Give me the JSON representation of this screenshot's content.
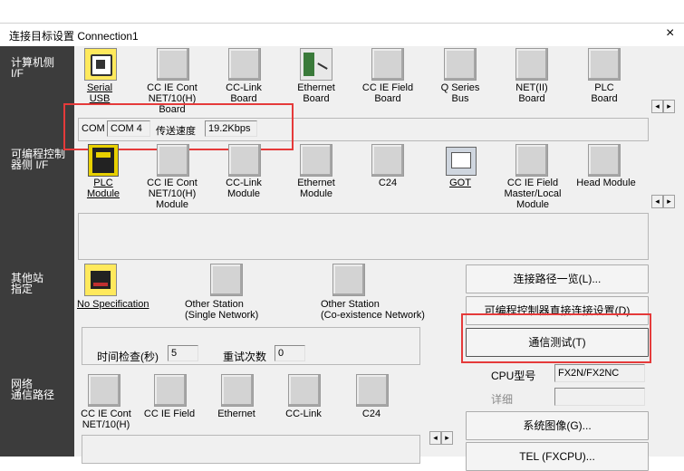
{
  "window": {
    "title": "连接目标设置 Connection1",
    "close": "×"
  },
  "sections": {
    "pc_if": "计算机侧\nI/F",
    "plc_if": "可编程控制\n器侧 I/F",
    "other_station": "其他站\n指定",
    "network_route": "网络\n通信路径"
  },
  "pc_if_items": [
    "Serial\nUSB",
    "CC IE Cont\nNET/10(H)\nBoard",
    "CC-Link\nBoard",
    "Ethernet\nBoard",
    "CC IE Field\nBoard",
    "Q Series\nBus",
    "NET(II)\nBoard",
    "PLC\nBoard"
  ],
  "com_row": {
    "com_label": "COM",
    "com_value": "COM 4",
    "speed_label": "传送速度",
    "speed_value": "19.2Kbps"
  },
  "plc_if_items": [
    "PLC\nModule",
    "CC IE Cont\nNET/10(H)\nModule",
    "CC-Link\nModule",
    "Ethernet\nModule",
    "C24",
    "GOT",
    "CC IE Field\nMaster/Local\nModule",
    "Head Module"
  ],
  "other_items": [
    "No Specification",
    "Other Station\n(Single Network)",
    "Other Station\n(Co-existence Network)"
  ],
  "time_check": {
    "label": "时间检查(秒)",
    "value": "5",
    "retry_label": "重试次数",
    "retry_value": "0"
  },
  "network_items": [
    "CC IE Cont\nNET/10(H)",
    "CC IE Field",
    "Ethernet",
    "CC-Link",
    "C24"
  ],
  "buttons": {
    "route_list": "连接路径一览(L)...",
    "direct": "可编程控制器直接连接设置(D)",
    "test": "通信测试(T)",
    "system_image": "系统图像(G)...",
    "tel": "TEL (FXCPU)..."
  },
  "cpu": {
    "label": "CPU型号",
    "value": "FX2N/FX2NC",
    "detail_label": "详细",
    "detail_value": ""
  },
  "scroll": {
    "left": "◂",
    "right": "▸"
  }
}
